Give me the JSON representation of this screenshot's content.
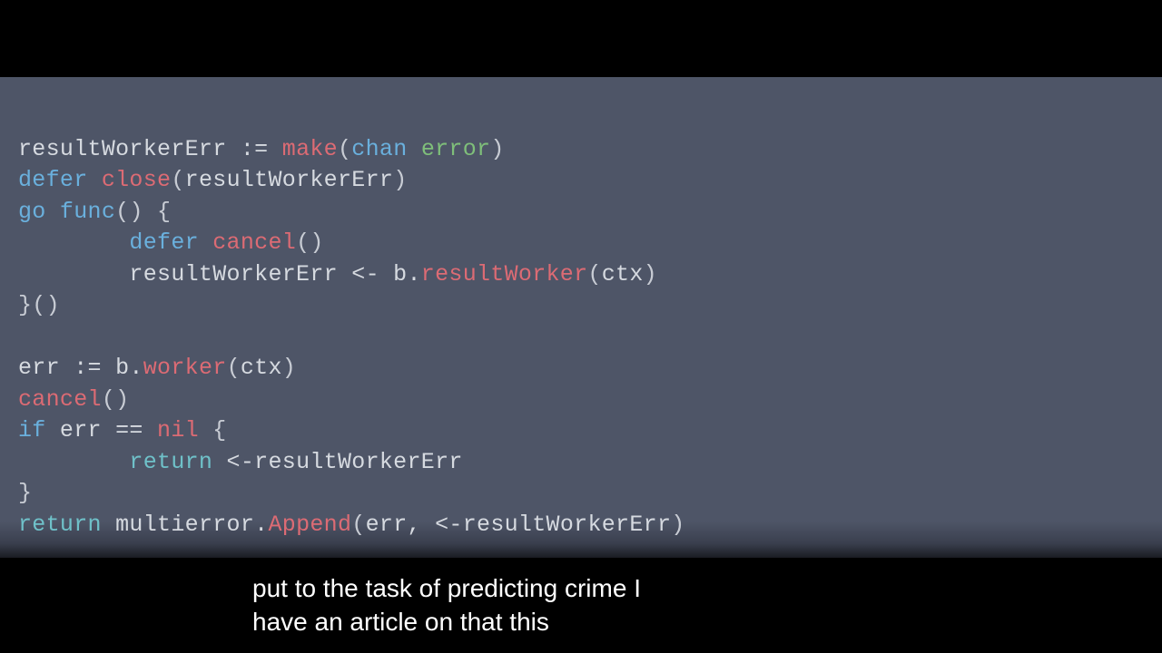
{
  "code": {
    "line1": {
      "ident": "resultWorkerErr",
      "assign": " := ",
      "make": "make",
      "paren_open": "(",
      "chan": "chan",
      "sp": " ",
      "error": "error",
      "paren_close": ")"
    },
    "line2": {
      "defer": "defer",
      "sp": " ",
      "close": "close",
      "paren_open": "(",
      "arg": "resultWorkerErr",
      "paren_close": ")"
    },
    "line3": {
      "go": "go",
      "sp": " ",
      "func": "func",
      "rest": "() {"
    },
    "line4": {
      "indent": "        ",
      "defer": "defer",
      "sp": " ",
      "cancel": "cancel",
      "rest": "()"
    },
    "line5": {
      "indent": "        ",
      "left": "resultWorkerErr <- b.",
      "method": "resultWorker",
      "paren_open": "(",
      "arg": "ctx",
      "paren_close": ")"
    },
    "line6": {
      "text": "}()"
    },
    "line7_blank": "",
    "line8": {
      "left": "err := b.",
      "method": "worker",
      "paren_open": "(",
      "arg": "ctx",
      "paren_close": ")"
    },
    "line9": {
      "cancel": "cancel",
      "rest": "()"
    },
    "line10": {
      "if": "if",
      "mid": " err == ",
      "nil": "nil",
      "brace": " {"
    },
    "line11": {
      "indent": "        ",
      "return": "return",
      "rest": " <-resultWorkerErr"
    },
    "line12": {
      "text": "}"
    },
    "line13": {
      "return": "return",
      "mid": " multierror.",
      "append": "Append",
      "paren_open": "(",
      "args": "err, <-resultWorkerErr",
      "paren_close": ")"
    }
  },
  "subtitle": {
    "text": "put to the task of predicting crime I\nhave an article on that this"
  }
}
